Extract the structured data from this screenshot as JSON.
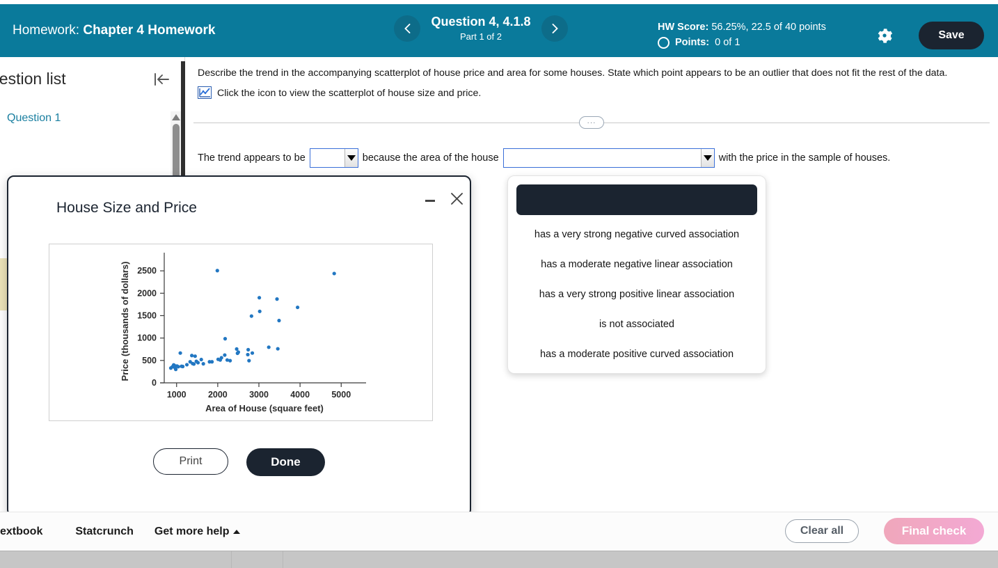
{
  "header": {
    "homework_label": "Homework:",
    "homework_name": "Chapter 4 Homework",
    "prev_icon": "chevron-left-icon",
    "next_icon": "chevron-right-icon",
    "question_title": "Question 4, 4.1.8",
    "question_part": "Part 1 of 2",
    "hw_score_label": "HW Score:",
    "hw_score_value": "56.25%, 22.5 of 40 points",
    "points_label": "Points:",
    "points_value": "0 of 1",
    "gear_icon": "gear-icon",
    "save_label": "Save",
    "bg_color": "#0a7a9b",
    "save_bg": "#1b2430"
  },
  "sidebar": {
    "title": "uestion list",
    "collapse_icon": "collapse-left-icon",
    "items": [
      {
        "label": "Question 1"
      }
    ]
  },
  "question": {
    "prompt": "Describe the trend in the accompanying scatterplot of house price and area for some houses. State which point appears to be an outlier that does not fit the rest of the data.",
    "icon_name": "scatterplot-icon",
    "icon_instruction": "Click the icon to view the scatterplot of house size and price.",
    "divider_label": "···"
  },
  "answer": {
    "text_before": "The trend appears to be",
    "dropdown1_value": "",
    "text_middle": "because the area of the house",
    "dropdown2_value": "",
    "text_after": "with the price in the sample of houses.",
    "dropdown_icon": "chevron-down-icon"
  },
  "dropdown": {
    "selected_value": "",
    "options": [
      "has a very strong negative curved association",
      "has a moderate negative linear association",
      "has a very strong positive linear association",
      "is not associated",
      "has a moderate positive curved association"
    ]
  },
  "modal": {
    "title": "House Size and Price",
    "minimize_icon": "minimize-icon",
    "close_icon": "close-icon",
    "print_label": "Print",
    "done_label": "Done"
  },
  "bottom_bar": {
    "links": [
      {
        "label": "extbook"
      },
      {
        "label": "Statcrunch"
      },
      {
        "label": "Get more help",
        "caret": "caret-up-icon"
      }
    ],
    "clear_all_label": "Clear all",
    "final_check_label": "Final check"
  },
  "chart_data": {
    "type": "scatter",
    "title": "House Size and Price",
    "xlabel": "Area of House (square feet)",
    "ylabel": "Price (thousands of dollars)",
    "xlim": [
      700,
      5300
    ],
    "ylim": [
      0,
      2750
    ],
    "xticks": [
      1000,
      2000,
      3000,
      4000,
      5000
    ],
    "yticks": [
      0,
      500,
      1000,
      1500,
      2000,
      2500
    ],
    "grid": false,
    "legend": false,
    "point_color": "#2277c2",
    "points": [
      [
        860,
        330
      ],
      [
        900,
        360
      ],
      [
        930,
        400
      ],
      [
        950,
        385
      ],
      [
        960,
        340
      ],
      [
        980,
        300
      ],
      [
        1010,
        375
      ],
      [
        1040,
        360
      ],
      [
        1090,
        665
      ],
      [
        1120,
        370
      ],
      [
        1150,
        365
      ],
      [
        1250,
        405
      ],
      [
        1330,
        470
      ],
      [
        1370,
        610
      ],
      [
        1390,
        430
      ],
      [
        1420,
        420
      ],
      [
        1450,
        595
      ],
      [
        1480,
        480
      ],
      [
        1520,
        450
      ],
      [
        1600,
        520
      ],
      [
        1650,
        425
      ],
      [
        1800,
        470
      ],
      [
        1860,
        470
      ],
      [
        1990,
        2505
      ],
      [
        2010,
        525
      ],
      [
        2060,
        510
      ],
      [
        2090,
        560
      ],
      [
        2180,
        985
      ],
      [
        2170,
        620
      ],
      [
        2230,
        510
      ],
      [
        2300,
        495
      ],
      [
        2460,
        755
      ],
      [
        2480,
        660
      ],
      [
        2500,
        685
      ],
      [
        2740,
        740
      ],
      [
        2730,
        630
      ],
      [
        2760,
        495
      ],
      [
        2820,
        1490
      ],
      [
        2840,
        665
      ],
      [
        3010,
        1900
      ],
      [
        3020,
        1595
      ],
      [
        3240,
        795
      ],
      [
        3440,
        1870
      ],
      [
        3460,
        760
      ],
      [
        3490,
        1390
      ],
      [
        3940,
        1685
      ],
      [
        4830,
        2440
      ]
    ],
    "outlier_note": "point near (2000, 2500) appears to be an outlier"
  }
}
